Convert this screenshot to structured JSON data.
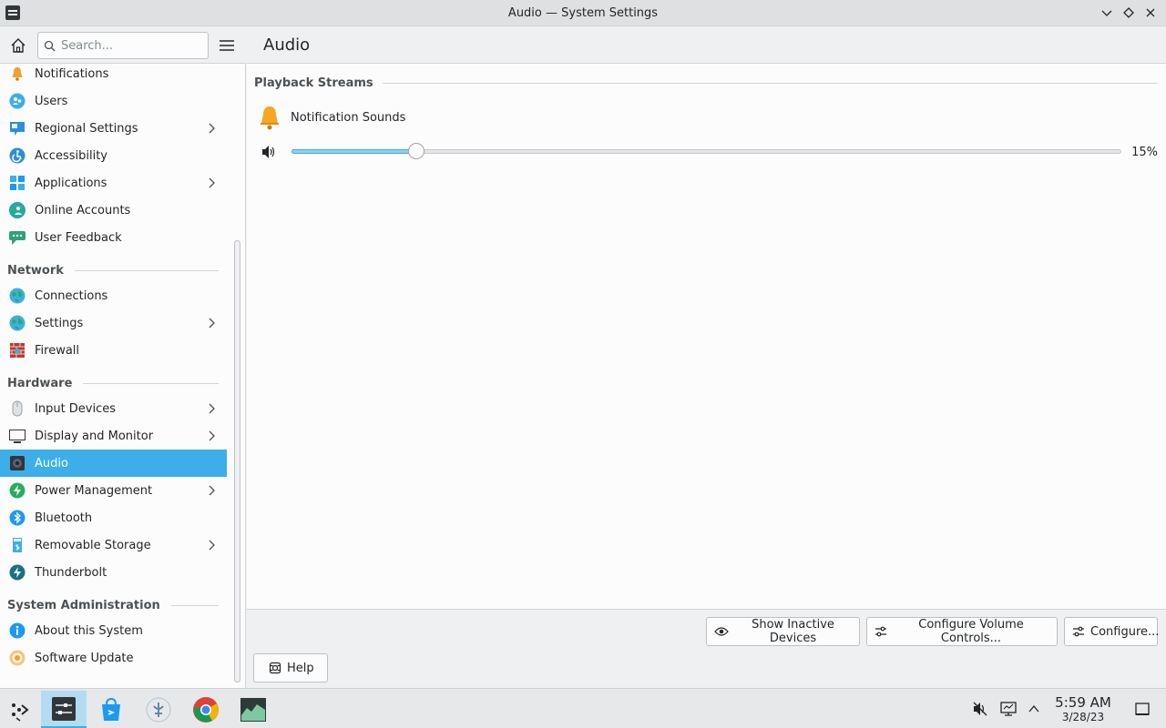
{
  "window": {
    "title": "Audio — System Settings"
  },
  "search": {
    "placeholder": "Search..."
  },
  "sidebar": {
    "items_top": [
      {
        "label": "Notifications",
        "icon": "bell-icon"
      },
      {
        "label": "Users",
        "icon": "users-icon"
      },
      {
        "label": "Regional Settings",
        "icon": "regional-icon",
        "has_children": true
      },
      {
        "label": "Accessibility",
        "icon": "accessibility-icon"
      },
      {
        "label": "Applications",
        "icon": "applications-icon",
        "has_children": true
      },
      {
        "label": "Online Accounts",
        "icon": "online-accounts-icon"
      },
      {
        "label": "User Feedback",
        "icon": "feedback-icon"
      }
    ],
    "section_network": "Network",
    "items_network": [
      {
        "label": "Connections",
        "icon": "globe-icon"
      },
      {
        "label": "Settings",
        "icon": "globe-icon",
        "has_children": true
      },
      {
        "label": "Firewall",
        "icon": "firewall-icon"
      }
    ],
    "section_hardware": "Hardware",
    "items_hardware": [
      {
        "label": "Input Devices",
        "icon": "mouse-icon",
        "has_children": true
      },
      {
        "label": "Display and Monitor",
        "icon": "monitor-icon",
        "has_children": true
      },
      {
        "label": "Audio",
        "icon": "speaker-icon",
        "selected": true
      },
      {
        "label": "Power Management",
        "icon": "power-icon",
        "has_children": true
      },
      {
        "label": "Bluetooth",
        "icon": "bluetooth-icon"
      },
      {
        "label": "Removable Storage",
        "icon": "storage-icon",
        "has_children": true
      },
      {
        "label": "Thunderbolt",
        "icon": "thunderbolt-icon"
      }
    ],
    "section_sysadmin": "System Administration",
    "items_sysadmin": [
      {
        "label": "About this System",
        "icon": "info-icon"
      },
      {
        "label": "Software Update",
        "icon": "update-icon"
      }
    ]
  },
  "page": {
    "title": "Audio",
    "section_label": "Playback Streams",
    "stream": {
      "name": "Notification Sounds",
      "volume_percent": 15,
      "volume_label": "15%"
    }
  },
  "buttons": {
    "show_inactive": "Show Inactive Devices",
    "configure_volume": "Configure Volume Controls...",
    "configure": "Configure...",
    "help": "Help"
  },
  "taskbar": {
    "time": "5:59 AM",
    "date": "3/28/23"
  },
  "colors": {
    "accent": "#3daee9",
    "selection_text": "#ffffff"
  }
}
